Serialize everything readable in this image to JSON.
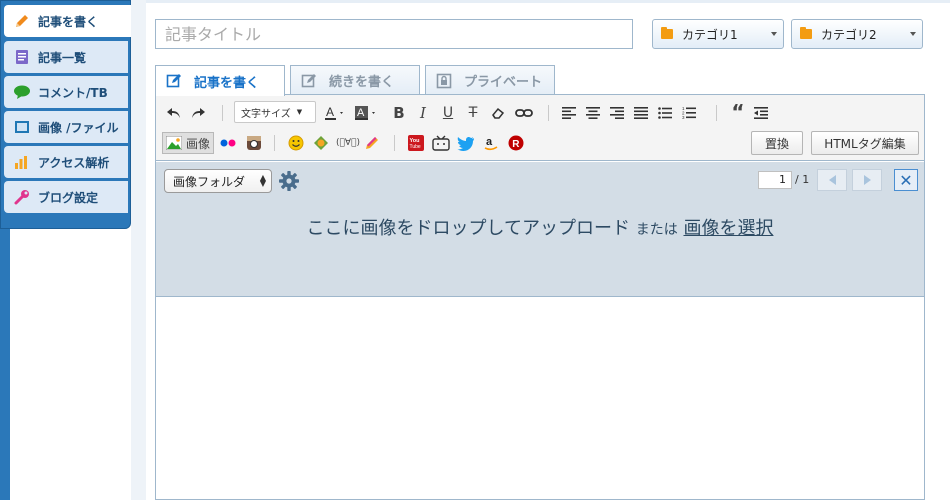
{
  "sidebar": {
    "items": [
      {
        "label": "記事を書く",
        "icon": "pencil-icon",
        "color": "#f08a1c",
        "active": true
      },
      {
        "label": "記事一覧",
        "icon": "document-list-icon",
        "color": "#7b68c9"
      },
      {
        "label": "コメント/TB",
        "icon": "speech-bubble-icon",
        "color": "#2ca02c"
      },
      {
        "label": "画像 /ファイル",
        "icon": "image-file-icon",
        "color": "#1f77b4"
      },
      {
        "label": "アクセス解析",
        "icon": "bar-chart-icon",
        "color": "#f5a623"
      },
      {
        "label": "ブログ設定",
        "icon": "wrench-icon",
        "color": "#e0358e"
      }
    ]
  },
  "title": {
    "placeholder": "記事タイトル"
  },
  "categories": {
    "cat1": "カテゴリ1",
    "cat2": "カテゴリ2"
  },
  "tabs": [
    {
      "label": "記事を書く",
      "icon": "edit-icon",
      "active": true
    },
    {
      "label": "続きを書く",
      "icon": "edit-more-icon"
    },
    {
      "label": "プライベート",
      "icon": "lock-icon"
    }
  ],
  "toolbar": {
    "font_size_label": "文字サイズ",
    "image_label": "画像",
    "replace_label": "置換",
    "html_edit_label": "HTMLタグ編集"
  },
  "upload": {
    "folder_label": "画像フォルダ",
    "page_current": "1",
    "page_total": "/ 1",
    "drop_text": "ここに画像をドロップしてアップロード",
    "or_text": "または",
    "select_link": "画像を選択"
  },
  "colors": {
    "sidebar_blue": "#2b78b9",
    "accent_blue": "#1a73c8",
    "upload_bg": "#d3dde6"
  }
}
